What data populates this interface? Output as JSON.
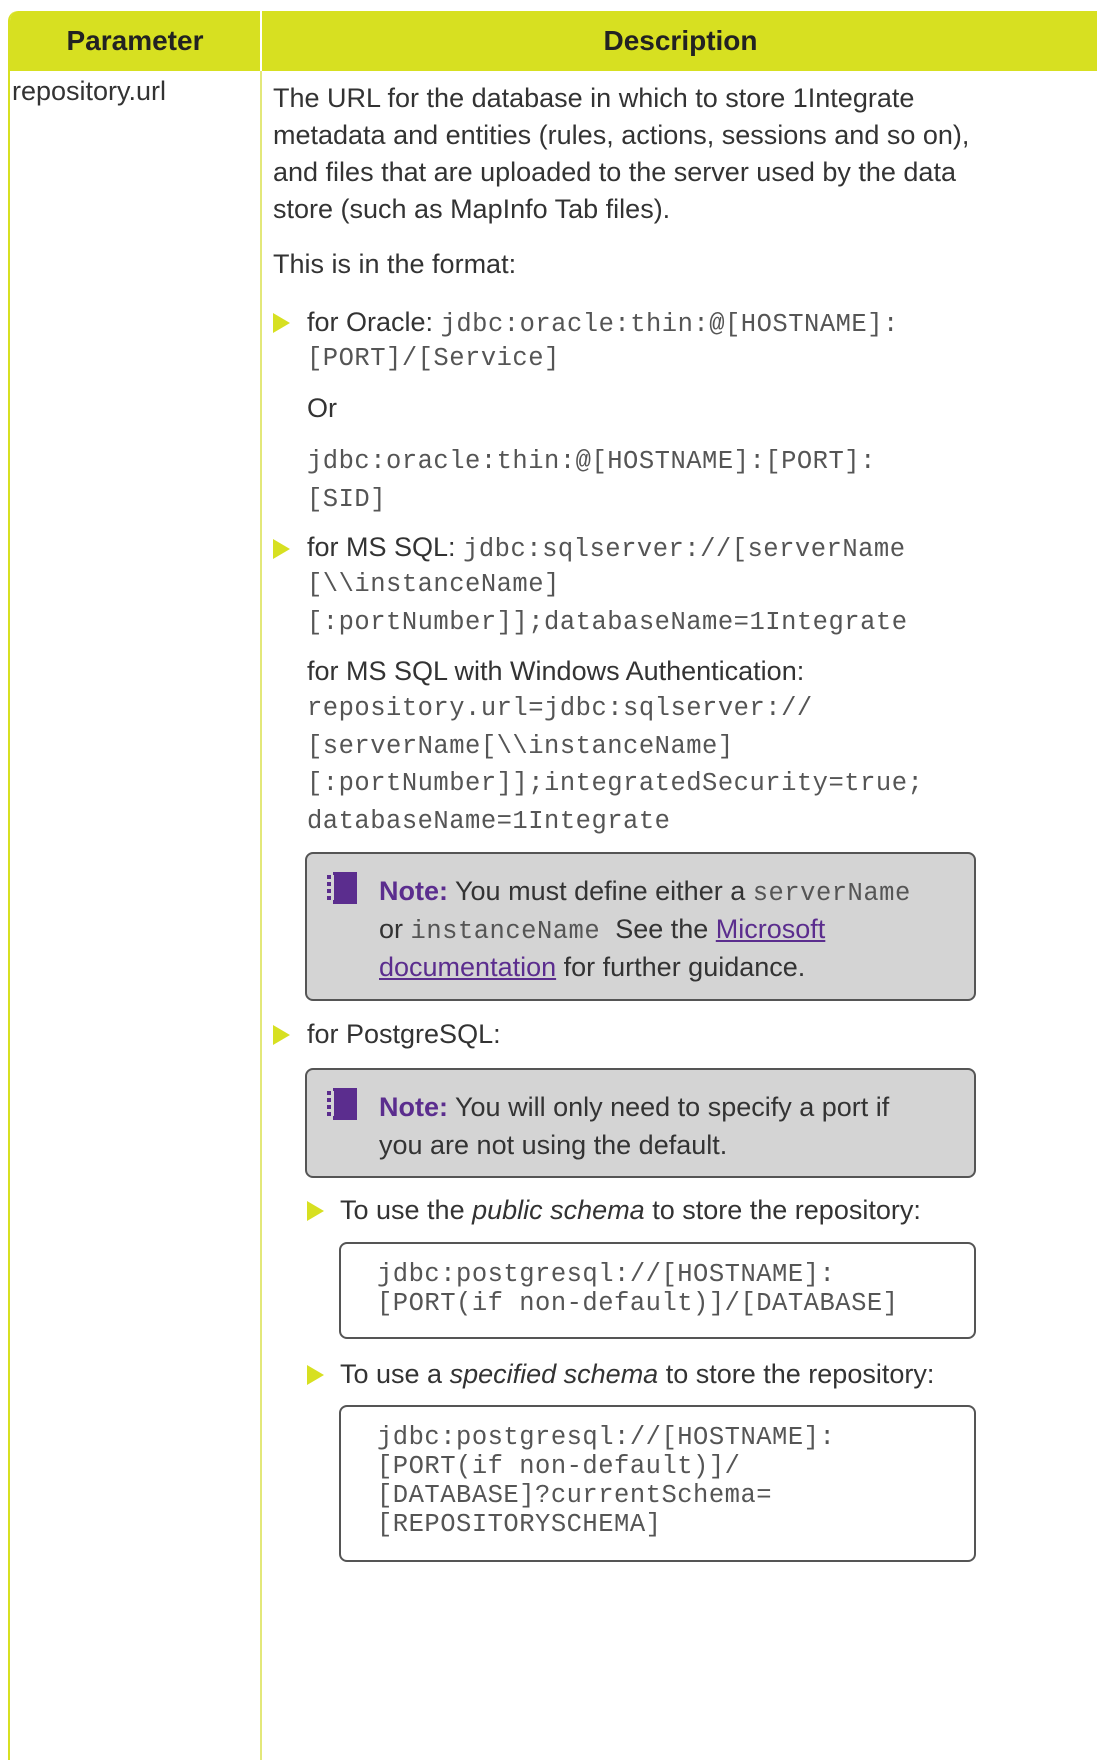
{
  "table": {
    "header": {
      "parameter": "Parameter",
      "description": "Description"
    },
    "row": {
      "parameter": "repository.url",
      "intro": "The URL for the database in which to store 1Integrate metadata and entities (rules, actions, sessions and so on), and files that are uploaded to the server used by the data store (such as MapInfo Tab files).",
      "format_text": "This is in the format:",
      "oracle": {
        "label": "for Oracle:",
        "code_1a": "jdbc:oracle:thin:@[HOSTNAME]:",
        "code_1b": "[PORT]/[Service]",
        "or": "Or",
        "code_2a": "jdbc:oracle:thin:@[HOSTNAME]:[PORT]:",
        "code_2b": "[SID]"
      },
      "mssql": {
        "label": "for MS SQL:",
        "code_1a": "jdbc:sqlserver://[serverName",
        "code_1b": "[\\\\instanceName]",
        "code_1c": "[:portNumber]];databaseName=1Integrate",
        "win_label": "for MS SQL with Windows Authentication:",
        "code_2a": "repository.url=jdbc:sqlserver://",
        "code_2b": "[serverName[\\\\instanceName]",
        "code_2c": "[:portNumber]];integratedSecurity=true;",
        "code_2d": "databaseName=1Integrate",
        "note": {
          "label": "Note:",
          "text_1": "You must define either a",
          "code_a": "serverName",
          "or": "or",
          "code_b": "instanceName",
          "text_2": "See the",
          "link_a": "Microsoft",
          "link_b": "documentation",
          "text_3": "for further guidance."
        }
      },
      "postgres": {
        "label": "for PostgreSQL:",
        "note": {
          "label": "Note:",
          "text_1": "You will only need to specify a port if",
          "text_2": "you are not using the default."
        },
        "public": {
          "text_a": "To use the",
          "em": "public schema",
          "text_b": "to store the repository:",
          "code": "jdbc:postgresql://[HOSTNAME]:\n[PORT(if non-default)]/[DATABASE]"
        },
        "specified": {
          "text_a": "To use a",
          "em": "specified schema",
          "text_b": "to store the repository:",
          "code": "jdbc:postgresql://[HOSTNAME]:\n[PORT(if non-default)]/\n[DATABASE]?currentSchema=\n[REPOSITORYSCHEMA]"
        }
      }
    }
  },
  "colors": {
    "header_bg": "#d7e021",
    "note_bg": "#d4d4d4",
    "note_label": "#5b2d8e",
    "bullet": "#d7e021"
  },
  "icons": {
    "bullet": "triangle-bullet-icon",
    "note": "notebook-icon"
  }
}
